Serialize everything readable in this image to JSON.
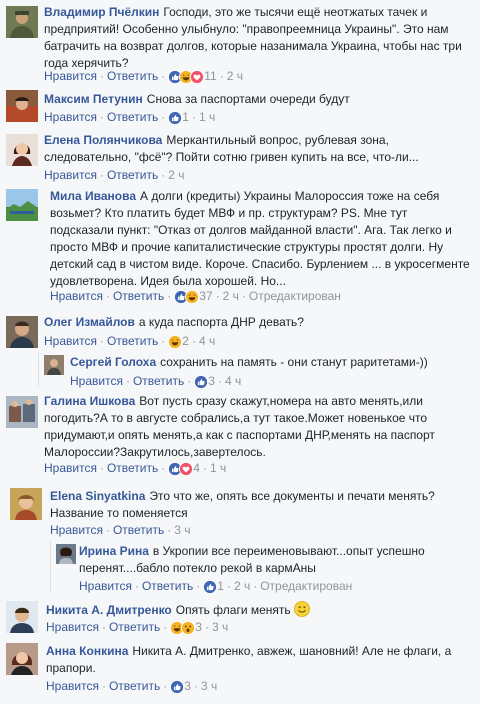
{
  "labels": {
    "like": "Нравится",
    "reply": "Ответить",
    "sep": "·"
  },
  "colors": {
    "link": "#365899",
    "meta": "#90949c",
    "text": "#1d2129",
    "like_blue": "#4267b2",
    "haha_yellow": "#f7b125",
    "love_red": "#f25268"
  },
  "comments": [
    {
      "author": "Владимир Пчёлкин",
      "text": "Господи, это же тысячи ещё неотжатых тачек и предприятий! Особенно улыбнуло: \"правопреемница Украины\". Это нам батрачить на возврат долгов, которые назанимала Украина, чтобы нас три года херячить?",
      "reactions": [
        "like",
        "haha",
        "love"
      ],
      "count": "11",
      "time": "2 ч"
    },
    {
      "author": "Максим Петунин",
      "text": "Снова за паспортами очереди будут",
      "reactions": [
        "like"
      ],
      "count": "1",
      "time": "1 ч"
    },
    {
      "author": "Елена Полянчикова",
      "text": "Меркантильный вопрос, рублевая зона, следовательно, \"фсё\"? Пойти сотню гривен купить на все, что-ли...",
      "reactions": [],
      "count": "",
      "time": "2 ч"
    },
    {
      "author": "Мила Иванова",
      "text": "А долги (кредиты) Украины Малороссия тоже на себя возьмет? Кто платить будет МВФ и пр. структурам? PS. Мне тут подсказали пункт: \"Отказ от долгов майданной власти\". Ага. Так легко и просто МВФ и прочие капиталистические структуры простят долги. Ну детский сад в чистом виде. Короче. Спасибо. Бурлением ... в укросегменте удовлетворена. Идея была хорошей. Но...",
      "reactions": [
        "like",
        "haha"
      ],
      "count": "37",
      "time": "2 ч",
      "edited": "Отредактирован"
    },
    {
      "author": "Олег Измайлов",
      "text": "а куда паспорта ДНР девать?",
      "reactions": [
        "haha"
      ],
      "count": "2",
      "time": "4 ч"
    },
    {
      "author": "Сергей Голоха",
      "text": "сохранить на память - они станут раритетами-))",
      "reactions": [
        "like"
      ],
      "count": "3",
      "time": "4 ч"
    },
    {
      "author": "Галина Ишкова",
      "text": "Вот пусть сразу скажут,номера на авто менять,или погодить?А то в августе собрались,а тут такое.Может новенькое что придумают,и опять менять,а как с паспортами ДНР,менять на паспорт Малороссии?Закрутилось,завертелось.",
      "reactions": [
        "like",
        "love"
      ],
      "count": "4",
      "time": "1 ч"
    },
    {
      "author": "Elena Sinyatkina",
      "text": "Это что же, опять все документы и печати менять? Название то поменяется",
      "reactions": [],
      "count": "",
      "time": "3 ч"
    },
    {
      "author": "Ирина Рина",
      "text": "в Укропии все переименовывают...опыт успешно перенят....бабло потекло рекой в кармАны",
      "reactions": [
        "like"
      ],
      "count": "1",
      "time": "2 ч",
      "edited": "Отредактирован"
    },
    {
      "author": "Никита А. Дмитренко",
      "text": "Опять флаги менять",
      "emoji": "smiley",
      "reactions": [
        "haha",
        "wow"
      ],
      "count": "3",
      "time": "3 ч"
    },
    {
      "author": "Анна Конкина",
      "text": "Никита А. Дмитренко, авжеж, шановний! Але не флаги, а прапори.",
      "reactions": [
        "like"
      ],
      "count": "3",
      "time": "3 ч"
    }
  ]
}
